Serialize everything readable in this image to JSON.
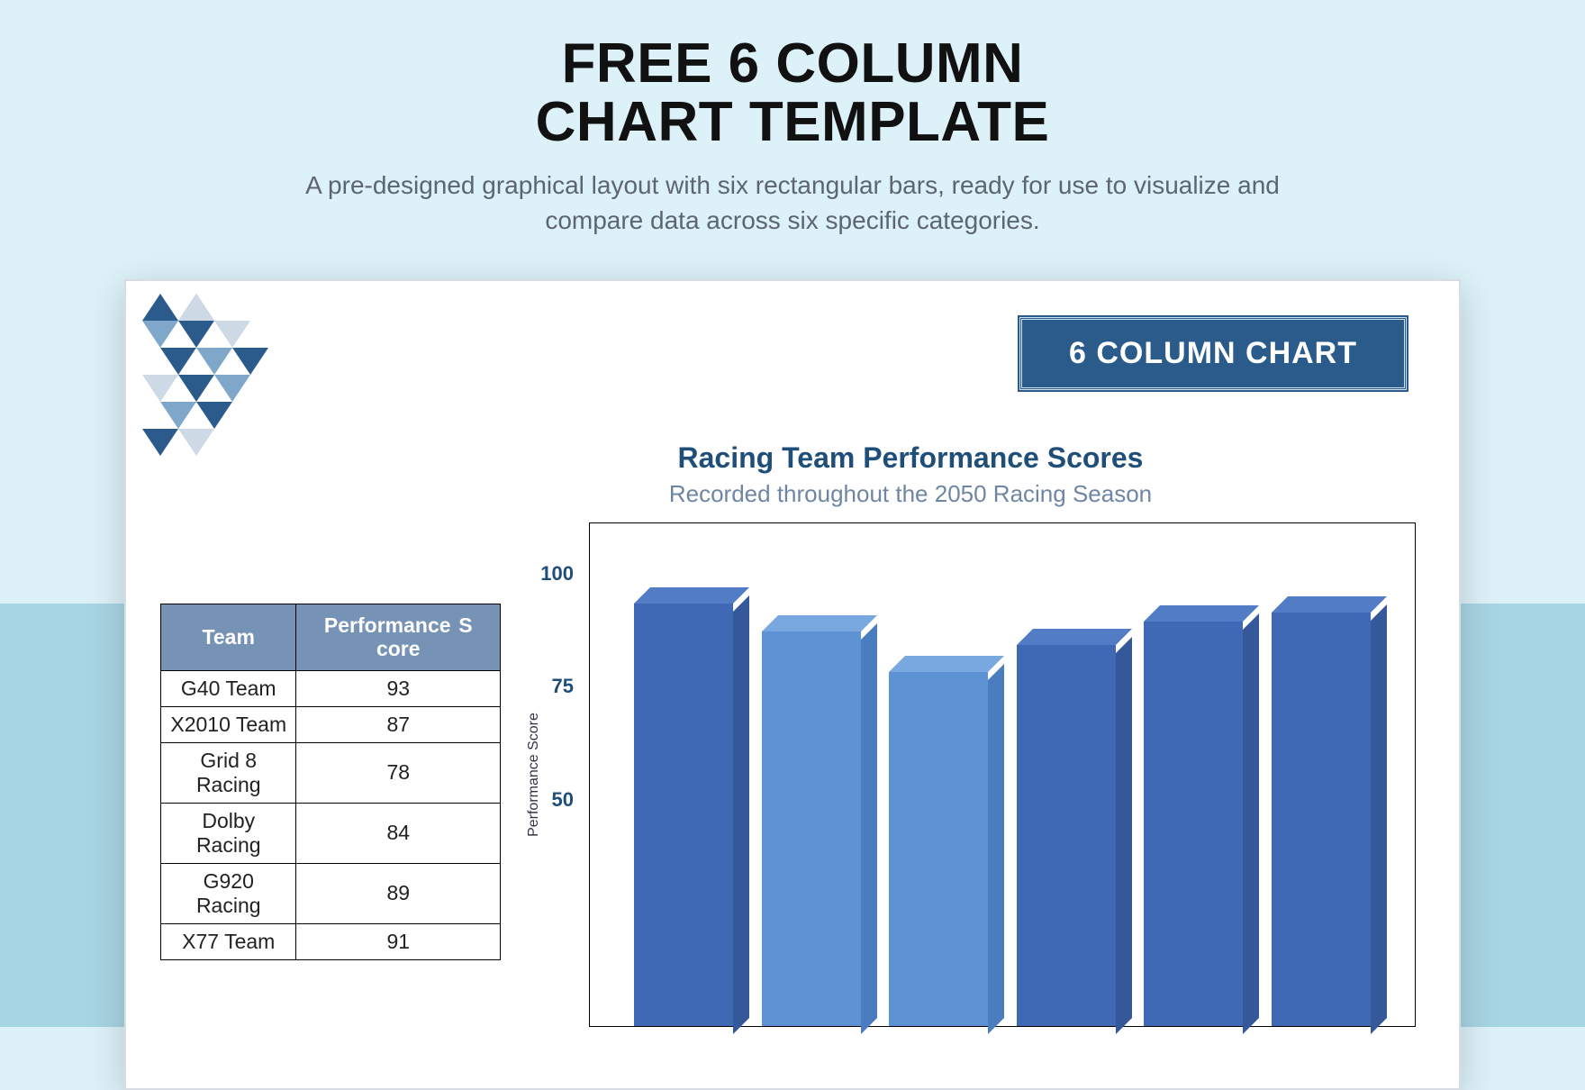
{
  "heading": {
    "title_line1": "FREE 6 COLUMN",
    "title_line2": "CHART TEMPLATE",
    "subtitle": "A pre-designed graphical layout with six rectangular bars, ready for use to visualize and compare data across six specific categories."
  },
  "doc": {
    "badge": "6 COLUMN CHART",
    "chart_title": "Racing Team Performance Scores",
    "chart_subtitle": "Recorded throughout the 2050 Racing Season",
    "yaxis_label": "Performance Score",
    "yticks": [
      "100",
      "75",
      "50"
    ],
    "table": {
      "headers": [
        "Team",
        "Performance S core"
      ],
      "rows": [
        {
          "team": "G40 Team",
          "score": "93"
        },
        {
          "team": "X2010 Team",
          "score": "87"
        },
        {
          "team": "Grid 8 Racing",
          "score": "78"
        },
        {
          "team": "Dolby Racing",
          "score": "84"
        },
        {
          "team": "G920 Racing",
          "score": "89"
        },
        {
          "team": "X77 Team",
          "score": "91"
        }
      ]
    }
  },
  "chart_data": {
    "type": "bar",
    "title": "Racing Team Performance Scores",
    "subtitle": "Recorded throughout the 2050 Racing Season",
    "xlabel": "Team",
    "ylabel": "Performance Score",
    "ylim": [
      0,
      100
    ],
    "yticks_visible": [
      50,
      75,
      100
    ],
    "categories": [
      "G40 Team",
      "X2010 Team",
      "Grid 8 Racing",
      "Dolby Racing",
      "G920 Racing",
      "X77 Team"
    ],
    "values": [
      93,
      87,
      78,
      84,
      89,
      91
    ],
    "colors": [
      "#3f69b5",
      "#5d92d4",
      "#5d92d4",
      "#3f69b5",
      "#3f69b5",
      "#3f69b5"
    ]
  }
}
